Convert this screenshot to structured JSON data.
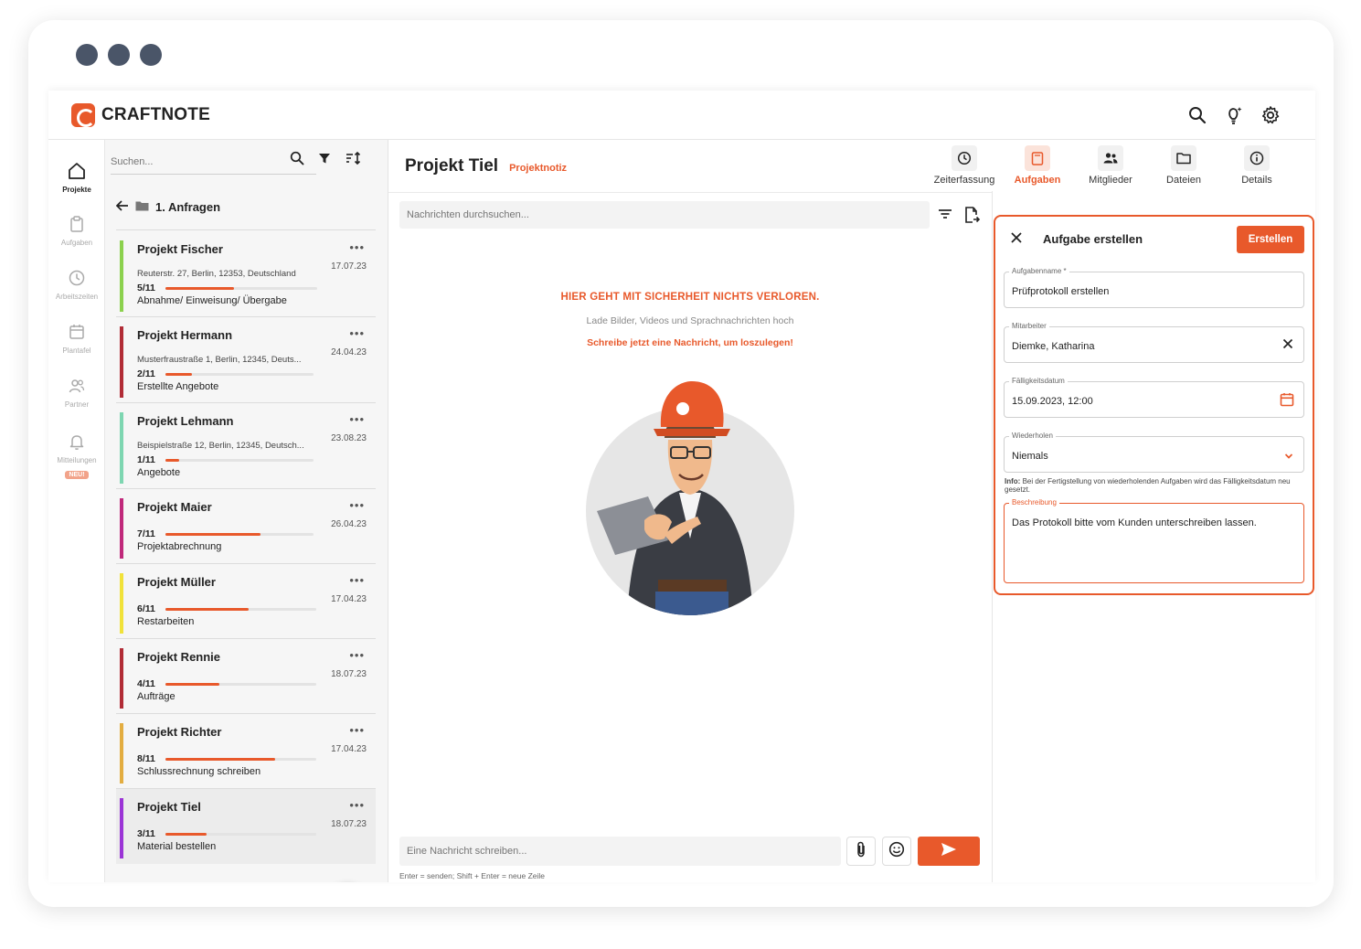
{
  "app": {
    "brand": "CRAFTNOTE",
    "accent": "#e8592b"
  },
  "rail": [
    {
      "label": "Projekte",
      "icon": "home-icon"
    },
    {
      "label": "Aufgaben",
      "icon": "clipboard-icon"
    },
    {
      "label": "Arbeitszeiten",
      "icon": "clock-icon"
    },
    {
      "label": "Plantafel",
      "icon": "calendar-icon"
    },
    {
      "label": "Partner",
      "icon": "users-icon"
    },
    {
      "label": "Mitteilungen",
      "icon": "bell-icon",
      "badge": "NEU!"
    }
  ],
  "projects_panel": {
    "search_placeholder": "Suchen...",
    "folder": "1. Anfragen",
    "projects": [
      {
        "name": "Projekt Fischer",
        "address": "Reuterstr. 27, Berlin, 12353, Deutschland",
        "date": "17.07.23",
        "count": "5/11",
        "progress": 0.45,
        "stage": "Abnahme/ Einweisung/ Übergabe",
        "color": "#8cd14e"
      },
      {
        "name": "Projekt Hermann",
        "address": "Musterfraustraße 1, Berlin, 12345, Deuts...",
        "date": "24.04.23",
        "count": "2/11",
        "progress": 0.18,
        "stage": "Erstellte Angebote",
        "color": "#b12c36"
      },
      {
        "name": "Projekt Lehmann",
        "address": "Beispielstraße 12, Berlin, 12345, Deutsch...",
        "date": "23.08.23",
        "count": "1/11",
        "progress": 0.09,
        "stage": "Angebote",
        "color": "#7ed6b1"
      },
      {
        "name": "Projekt Maier",
        "address": "",
        "date": "26.04.23",
        "count": "7/11",
        "progress": 0.64,
        "stage": "Projektabrechnung",
        "color": "#c0297b"
      },
      {
        "name": "Projekt Müller",
        "address": "",
        "date": "17.04.23",
        "count": "6/11",
        "progress": 0.55,
        "stage": "Restarbeiten",
        "color": "#f1e23a"
      },
      {
        "name": "Projekt Rennie",
        "address": "",
        "date": "18.07.23",
        "count": "4/11",
        "progress": 0.36,
        "stage": "Aufträge",
        "color": "#b12c36"
      },
      {
        "name": "Projekt Richter",
        "address": "",
        "date": "17.04.23",
        "count": "8/11",
        "progress": 0.73,
        "stage": "Schlussrechnung schreiben",
        "color": "#e3ad41"
      },
      {
        "name": "Projekt Tiel",
        "address": "",
        "date": "18.07.23",
        "count": "3/11",
        "progress": 0.27,
        "stage": "Material bestellen",
        "color": "#9b34d6"
      }
    ]
  },
  "main": {
    "title": "Projekt Tiel",
    "subtitle": "Projektnotiz",
    "search_placeholder": "Nachrichten durchsuchen...",
    "empty_heading": "HIER GEHT MIT SICHERHEIT NICHTS VERLOREN.",
    "empty_sub": "Lade Bilder, Videos und Sprachnachrichten hoch",
    "empty_cta": "Schreibe jetzt eine Nachricht, um loszulegen!",
    "message_placeholder": "Eine Nachricht schreiben...",
    "message_hint": "Enter = senden; Shift + Enter = neue Zeile"
  },
  "tabs": [
    {
      "label": "Zeiterfassung",
      "icon": "clock-icon"
    },
    {
      "label": "Aufgaben",
      "icon": "clipboard-icon",
      "active": true
    },
    {
      "label": "Mitglieder",
      "icon": "users-icon"
    },
    {
      "label": "Dateien",
      "icon": "folder-icon"
    },
    {
      "label": "Details",
      "icon": "info-icon"
    }
  ],
  "task_form": {
    "title": "Aufgabe erstellen",
    "create_label": "Erstellen",
    "name_label": "Aufgabenname *",
    "name_value": "Prüfprotokoll erstellen",
    "assignee_label": "Mitarbeiter",
    "assignee_value": "Diemke, Katharina",
    "due_label": "Fälligkeitsdatum",
    "due_value": "15.09.2023, 12:00",
    "repeat_label": "Wiederholen",
    "repeat_value": "Niemals",
    "info_prefix": "Info:",
    "info_text": "Bei der Fertigstellung von wiederholenden Aufgaben wird das Fälligkeitsdatum neu gesetzt.",
    "desc_label": "Beschreibung",
    "desc_value": "Das Protokoll bitte vom Kunden unterschreiben lassen."
  }
}
